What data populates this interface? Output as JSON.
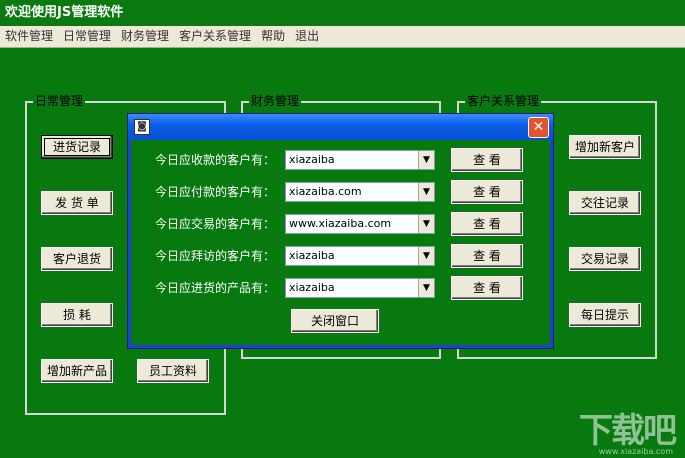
{
  "window": {
    "title": "欢迎使用JS管理软件"
  },
  "menu": [
    "软件管理",
    "日常管理",
    "财务管理",
    "客户关系管理",
    "帮助",
    "退出"
  ],
  "groups": {
    "daily": {
      "title": "日常管理",
      "buttons": [
        "进货记录",
        "发 货 单",
        "客户退货",
        "损 耗",
        "增加新产品",
        "员工资料"
      ]
    },
    "finance": {
      "title": "财务管理"
    },
    "crm": {
      "title": "客户关系管理",
      "buttons": [
        "增加新客户",
        "交往记录",
        "交易记录",
        "每日提示"
      ]
    }
  },
  "dialog": {
    "icon": "app-icon",
    "close_label": "✕",
    "rows": [
      {
        "label": "今日应收款的客户有：",
        "value": "xiazaiba",
        "button": "查 看"
      },
      {
        "label": "今日应付款的客户有：",
        "value": "xiazaiba.com",
        "button": "查 看"
      },
      {
        "label": "今日应交易的客户有：",
        "value": "www.xiazaiba.com",
        "button": "查 看"
      },
      {
        "label": "今日应拜访的客户有：",
        "value": "xiazaiba",
        "button": "查 看"
      },
      {
        "label": "今日应进货的产品有：",
        "value": "xiazaiba",
        "button": "查 看"
      }
    ],
    "close_button": "关闭窗口"
  },
  "watermark": {
    "text": "下载吧",
    "sub": "www.xiazaiba.com"
  },
  "colors": {
    "background": "#08790f",
    "dialog_frame": "#0a5fe6",
    "button_face": "#ece9d8"
  }
}
